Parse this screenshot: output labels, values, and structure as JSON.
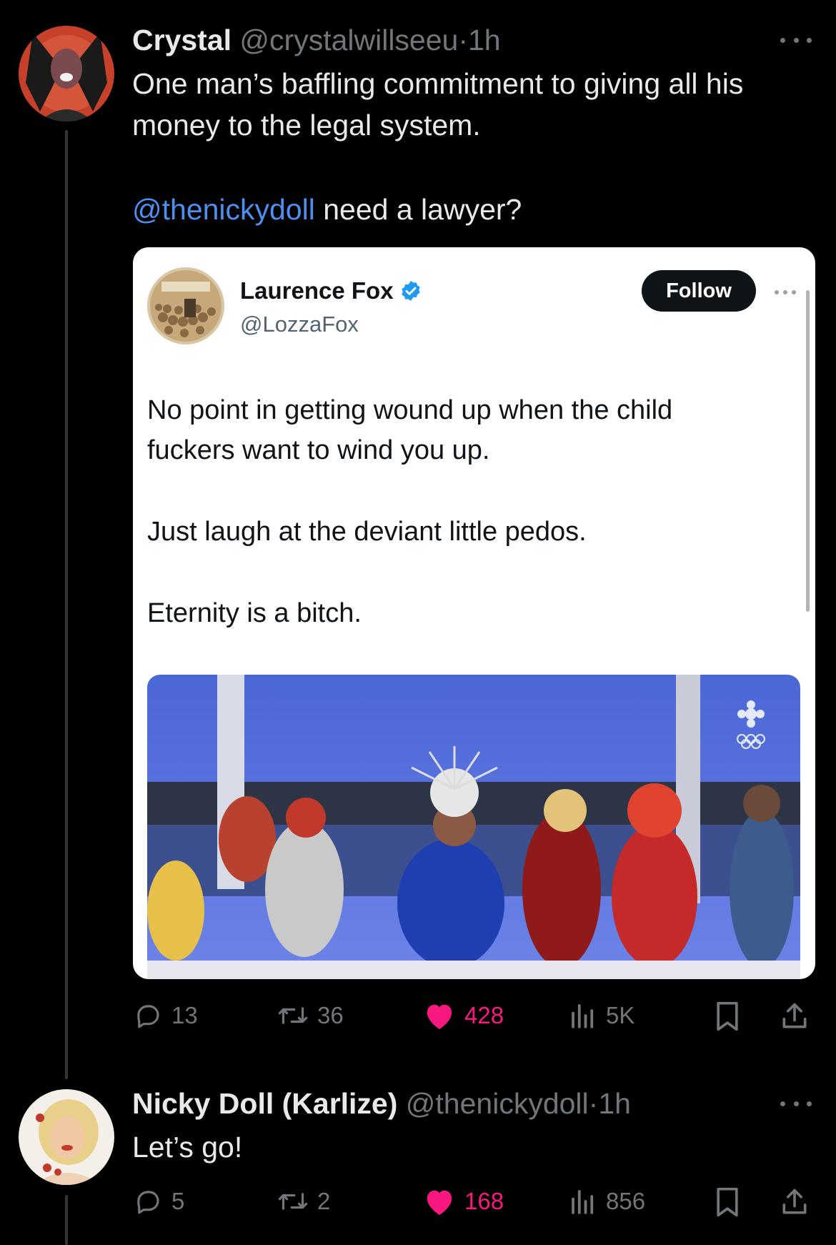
{
  "colors": {
    "background": "#000000",
    "text": "#e7e9ea",
    "muted": "#71767b",
    "link": "#4c8ff0",
    "like": "#f91880",
    "verified": "#1d9bf0"
  },
  "tweet1": {
    "name": "Crystal",
    "handle": "@crystalwillseeu",
    "separator": "·",
    "time": "1h",
    "text_line1": "One man’s baffling commitment to giving all his",
    "text_line2": "money to the legal system.",
    "mention": "@thenickydoll",
    "text_after_mention": " need a lawyer?",
    "quoted": {
      "name": "Laurence Fox",
      "verified_icon": "verified-badge-icon",
      "handle": "@LozzaFox",
      "follow_label": "Follow",
      "body_line1": "No point in getting wound up when the child",
      "body_line2": "fuckers want to wind you up.",
      "body_line3": "Just laugh at the deviant little pedos.",
      "body_line4": "Eternity is a bitch."
    },
    "stats": {
      "replies": "13",
      "reposts": "36",
      "likes": "428",
      "views": "5K"
    }
  },
  "tweet2": {
    "name": "Nicky Doll (Karlize)",
    "handle": "@thenickydoll",
    "separator": "·",
    "time": "1h",
    "text": "Let’s go!",
    "stats": {
      "replies": "5",
      "reposts": "2",
      "likes": "168",
      "views": "856"
    }
  }
}
